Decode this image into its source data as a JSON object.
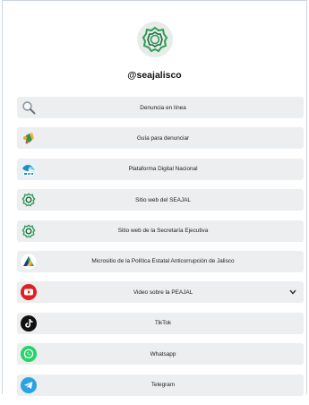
{
  "profile": {
    "handle": "@seajalisco",
    "avatar_icon": "seajal-logo-icon",
    "accent": "#2e9d57"
  },
  "links": [
    {
      "label": "Denuncia en línea",
      "icon": "magnifier-icon"
    },
    {
      "label": "Guía para denunciar",
      "icon": "pointing-hand-icon"
    },
    {
      "label": "Plataforma Digital Nacional",
      "icon": "pdn-logo-icon"
    },
    {
      "label": "Sitio web del SEAJAL",
      "icon": "seajal-logo-icon"
    },
    {
      "label": "Sitio web de la Secretaría Ejecutiva",
      "icon": "seajal-logo-icon"
    },
    {
      "label": "Micrositio de la Política Estatal Anticorrupción de Jalisco",
      "icon": "pea-logo-icon"
    },
    {
      "label": "Video sobre la PEAJAL",
      "icon": "youtube-icon",
      "expand_icon": "chevron-down-icon"
    },
    {
      "label": "TikTok",
      "icon": "tiktok-icon"
    },
    {
      "label": "Whatsapp",
      "icon": "whatsapp-icon"
    },
    {
      "label": "Telegram",
      "icon": "telegram-icon"
    }
  ],
  "colors": {
    "link_bg": "#eceeef",
    "youtube": "#e02020",
    "whatsapp": "#25d366",
    "telegram": "#2aa3e0",
    "tiktok": "#111111"
  }
}
